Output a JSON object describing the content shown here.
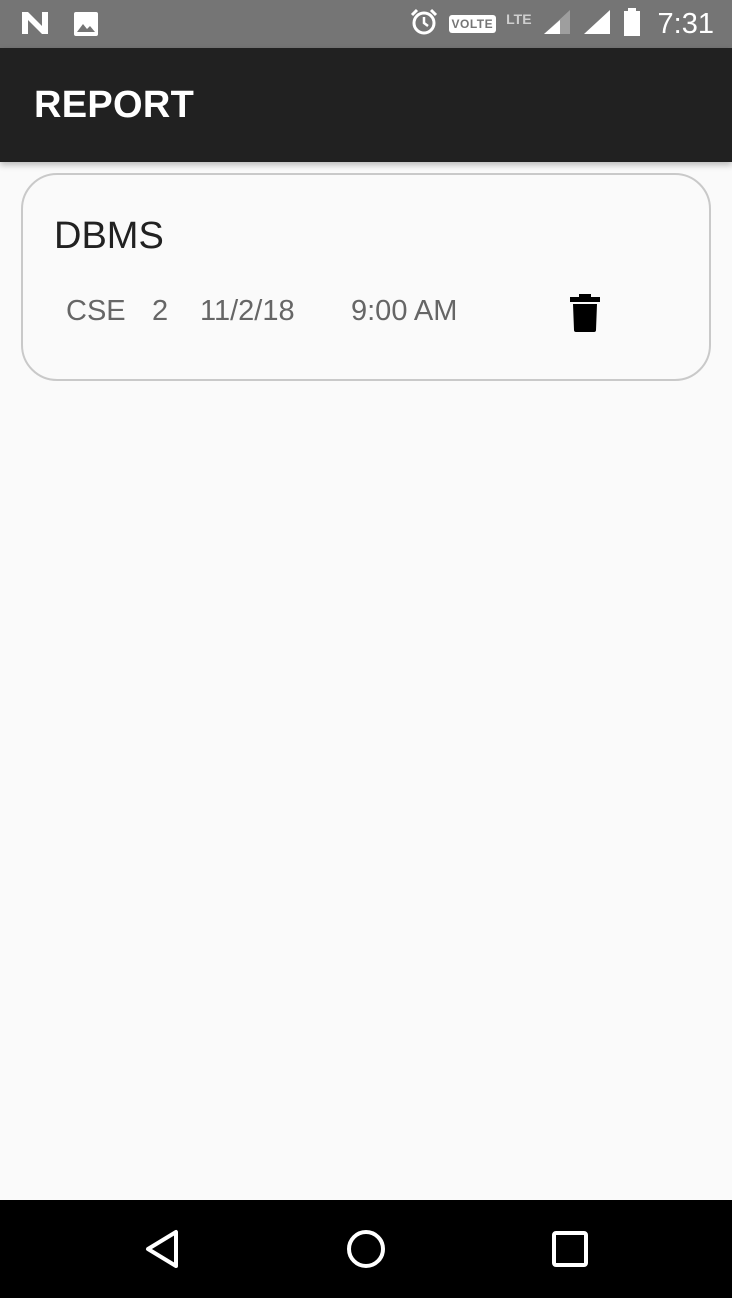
{
  "status_bar": {
    "left_icons": [
      "notification-n-icon",
      "image-icon"
    ],
    "volte_label": "VOLTE",
    "lte_label": "LTE",
    "time": "7:31"
  },
  "app_bar": {
    "title": "REPORT"
  },
  "report_card": {
    "subject": "DBMS",
    "branch": "CSE",
    "section": "2",
    "date": "11/2/18",
    "time": "9:00 AM",
    "delete_icon": "trash-icon"
  },
  "nav_bar": {
    "buttons": [
      "back-icon",
      "home-icon",
      "recents-icon"
    ]
  }
}
